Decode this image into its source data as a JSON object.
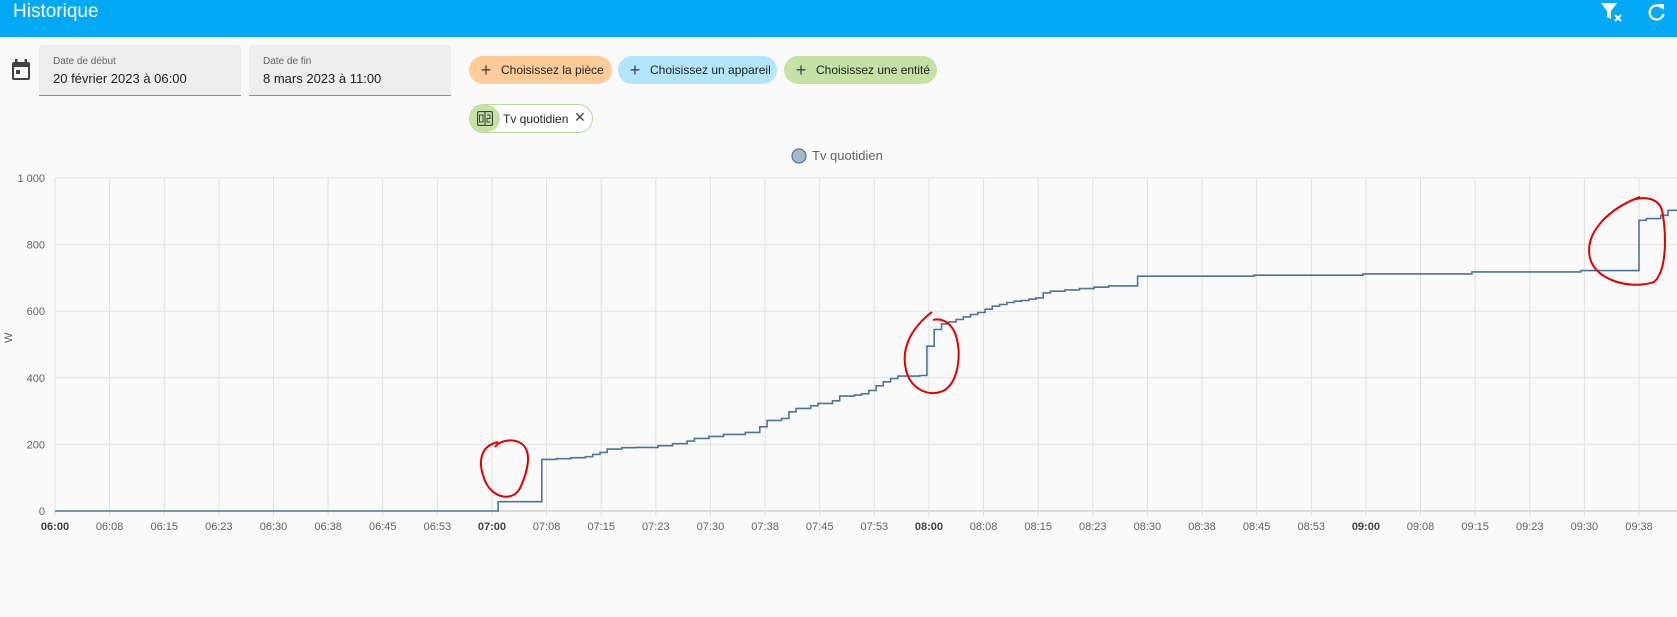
{
  "header": {
    "title": "Historique",
    "actions": [
      {
        "icon": "filter-remove-icon"
      },
      {
        "icon": "refresh-icon"
      }
    ]
  },
  "date_range": {
    "icon": "calendar-icon",
    "start": {
      "label": "Date de début",
      "value": "20 février 2023 à 06:00"
    },
    "end": {
      "label": "Date de fin",
      "value": "8 mars 2023 à 11:00"
    }
  },
  "target_picker": {
    "area_label": "Choisissez la pièce",
    "device_label": "Choisissez un appareil",
    "entity_label": "Choisissez une entité",
    "area_color": "#ffcc99",
    "device_color": "#b3e5fc",
    "entity_color": "#c5e1a5"
  },
  "selected_entity": {
    "name": "Tv quotidien",
    "icon": "counter-icon"
  },
  "chart_data": {
    "type": "line",
    "step": true,
    "legend": [
      "Tv quotidien"
    ],
    "legend_position": "top-center",
    "series": [
      {
        "name": "Tv quotidien",
        "color": "#4f7499",
        "points": [
          [
            "06:00",
            0
          ],
          [
            "07:01",
            0
          ],
          [
            "07:01",
            28
          ],
          [
            "07:07",
            28
          ],
          [
            "07:07",
            155
          ],
          [
            "07:09",
            157
          ],
          [
            "07:11",
            160
          ],
          [
            "07:13",
            163
          ],
          [
            "07:14",
            170
          ],
          [
            "07:15",
            176
          ],
          [
            "07:16",
            186
          ],
          [
            "07:18",
            190
          ],
          [
            "07:20",
            191
          ],
          [
            "07:23",
            196
          ],
          [
            "07:25",
            202
          ],
          [
            "07:27",
            210
          ],
          [
            "07:28",
            218
          ],
          [
            "07:30",
            224
          ],
          [
            "07:32",
            230
          ],
          [
            "07:35",
            236
          ],
          [
            "07:37",
            242
          ],
          [
            "07:37",
            253
          ],
          [
            "07:38",
            272
          ],
          [
            "07:40",
            278
          ],
          [
            "07:41",
            298
          ],
          [
            "07:42",
            308
          ],
          [
            "07:44",
            316
          ],
          [
            "07:45",
            323
          ],
          [
            "07:47",
            331
          ],
          [
            "07:48",
            345
          ],
          [
            "07:50",
            348
          ],
          [
            "07:51",
            352
          ],
          [
            "07:52",
            362
          ],
          [
            "07:53",
            376
          ],
          [
            "07:54",
            388
          ],
          [
            "07:55",
            398
          ],
          [
            "07:56",
            405
          ],
          [
            "07:59",
            407
          ],
          [
            "08:00",
            410
          ],
          [
            "08:00",
            495
          ],
          [
            "08:01",
            545
          ],
          [
            "08:02",
            553
          ],
          [
            "08:02",
            562
          ],
          [
            "08:03",
            568
          ],
          [
            "08:04",
            575
          ],
          [
            "08:05",
            583
          ],
          [
            "08:06",
            590
          ],
          [
            "08:07",
            596
          ],
          [
            "08:08",
            606
          ],
          [
            "08:09",
            615
          ],
          [
            "08:10",
            620
          ],
          [
            "08:11",
            626
          ],
          [
            "08:12",
            630
          ],
          [
            "08:13",
            632
          ],
          [
            "08:14",
            636
          ],
          [
            "08:15",
            640
          ],
          [
            "08:16",
            655
          ],
          [
            "08:17",
            660
          ],
          [
            "08:19",
            664
          ],
          [
            "08:21",
            668
          ],
          [
            "08:23",
            672
          ],
          [
            "08:25",
            676
          ],
          [
            "08:29",
            677
          ],
          [
            "08:29",
            705
          ],
          [
            "08:45",
            708
          ],
          [
            "09:00",
            712
          ],
          [
            "09:15",
            718
          ],
          [
            "09:30",
            722
          ],
          [
            "09:38",
            724
          ],
          [
            "09:38",
            873
          ],
          [
            "09:39",
            878
          ],
          [
            "09:41",
            888
          ],
          [
            "09:42",
            903
          ]
        ]
      }
    ],
    "x_ticks": [
      "06:00",
      "06:08",
      "06:15",
      "06:23",
      "06:30",
      "06:38",
      "06:45",
      "06:53",
      "07:00",
      "07:08",
      "07:15",
      "07:23",
      "07:30",
      "07:38",
      "07:45",
      "07:53",
      "08:00",
      "08:08",
      "08:15",
      "08:23",
      "08:30",
      "08:38",
      "08:45",
      "08:53",
      "09:00",
      "09:08",
      "09:15",
      "09:23",
      "09:30",
      "09:38"
    ],
    "bold_x_ticks": [
      "06:00",
      "07:00",
      "08:00",
      "09:00"
    ],
    "y_ticks": [
      "0",
      "200",
      "400",
      "600",
      "800",
      "1 000"
    ],
    "ylim": [
      0,
      1000
    ],
    "ylabel": "W",
    "grid": true,
    "annotations": [
      {
        "type": "circle",
        "color": "#e00000",
        "near": "07:00"
      },
      {
        "type": "circle",
        "color": "#e00000",
        "near": "08:00"
      },
      {
        "type": "circle",
        "color": "#e00000",
        "near": "09:38"
      }
    ]
  }
}
